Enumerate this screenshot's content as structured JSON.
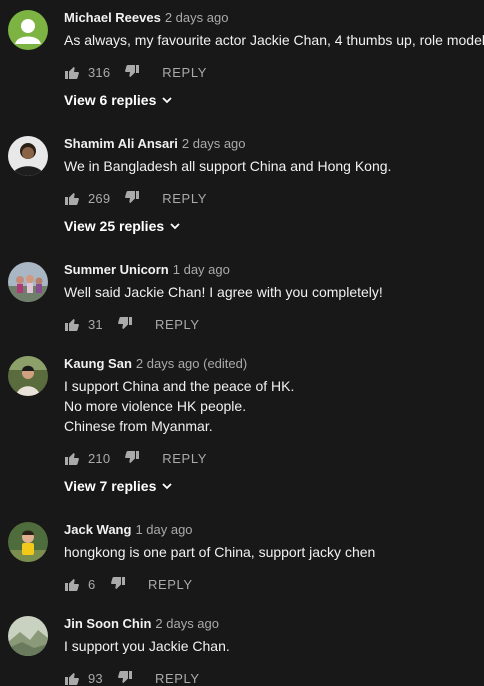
{
  "colors": {
    "background": "#181818",
    "text": "#f1f1f1",
    "secondary": "#aaaaaa"
  },
  "reply_label": "REPLY",
  "comments": [
    {
      "author": "Michael Reeves",
      "time": "2 days ago",
      "lines": [
        "As always, my favourite actor Jackie Chan, 4 thumbs up, role model"
      ],
      "likes": "316",
      "view_replies": "View 6 replies",
      "avatar_icon": "default-user-avatar-icon"
    },
    {
      "author": "Shamim Ali Ansari",
      "time": "2 days ago",
      "lines": [
        "We in Bangladesh all support China and Hong Kong."
      ],
      "likes": "269",
      "view_replies": "View 25 replies",
      "avatar_icon": "person-photo-avatar-icon"
    },
    {
      "author": "Summer Unicorn",
      "time": "1 day ago",
      "lines": [
        "Well said Jackie Chan! I agree with you completely!"
      ],
      "likes": "31",
      "view_replies": "",
      "avatar_icon": "group-photo-avatar-icon"
    },
    {
      "author": "Kaung San",
      "time": "2 days ago (edited)",
      "lines": [
        "I support China and the peace of HK.",
        "No more violence HK people.",
        "Chinese from Myanmar."
      ],
      "likes": "210",
      "view_replies": "View 7 replies",
      "avatar_icon": "person-photo-avatar-icon"
    },
    {
      "author": "Jack Wang",
      "time": "1 day ago",
      "lines": [
        "hongkong is one part of China, support jacky chen"
      ],
      "likes": "6",
      "view_replies": "",
      "avatar_icon": "child-photo-avatar-icon"
    },
    {
      "author": "Jin Soon Chin",
      "time": "2 days ago",
      "lines": [
        "I support you Jackie Chan."
      ],
      "likes": "93",
      "view_replies": "",
      "avatar_icon": "landscape-photo-avatar-icon"
    }
  ]
}
